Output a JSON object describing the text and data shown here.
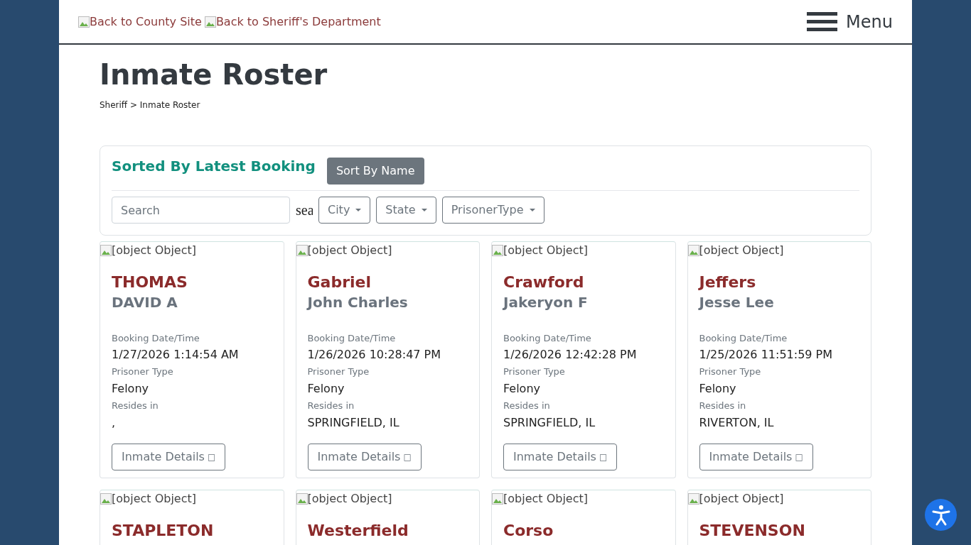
{
  "header": {
    "links": [
      "Back to County Site",
      "Back to Sheriff's Department"
    ],
    "menu": "Menu"
  },
  "title": "Inmate Roster",
  "breadcrumb": "Sheriff > Inmate Roster",
  "toolbar": {
    "heading": "Sorted By Latest Booking",
    "sort_button": "Sort By Name",
    "search": {
      "placeholder": "Search"
    },
    "search_label": "sea",
    "dropdowns": [
      "City",
      "State",
      "PrisonerType"
    ]
  },
  "inmates": [
    {
      "photo_alt": "[object Object]",
      "last": "THOMAS",
      "first": "DAVID A",
      "booking_label": "Booking Date/Time",
      "booking": "1/27/2026 1:14:54 AM",
      "type_label": "Prisoner Type",
      "type": "Felony",
      "resides_label": "Resides in",
      "resides": ",",
      "button": "Inmate Details",
      "button_glyph": "□"
    },
    {
      "photo_alt": "[object Object]",
      "last": "Gabriel",
      "first": "John Charles",
      "booking_label": "Booking Date/Time",
      "booking": "1/26/2026 10:28:47 PM",
      "type_label": "Prisoner Type",
      "type": "Felony",
      "resides_label": "Resides in",
      "resides": "SPRINGFIELD, IL",
      "button": "Inmate Details",
      "button_glyph": "□"
    },
    {
      "photo_alt": "[object Object]",
      "last": "Crawford",
      "first": "Jakeryon F",
      "booking_label": "Booking Date/Time",
      "booking": "1/26/2026 12:42:28 PM",
      "type_label": "Prisoner Type",
      "type": "Felony",
      "resides_label": "Resides in",
      "resides": "SPRINGFIELD, IL",
      "button": "Inmate Details",
      "button_glyph": "□"
    },
    {
      "photo_alt": "[object Object]",
      "last": "Jeffers",
      "first": "Jesse Lee",
      "booking_label": "Booking Date/Time",
      "booking": "1/25/2026 11:51:59 PM",
      "type_label": "Prisoner Type",
      "type": "Felony",
      "resides_label": "Resides in",
      "resides": "RIVERTON, IL",
      "button": "Inmate Details",
      "button_glyph": "□"
    },
    {
      "photo_alt": "[object Object]",
      "last": "STAPLETON"
    },
    {
      "photo_alt": "[object Object]",
      "last": "Westerfield"
    },
    {
      "photo_alt": "[object Object]",
      "last": "Corso"
    },
    {
      "photo_alt": "[object Object]",
      "last": "STEVENSON"
    }
  ]
}
